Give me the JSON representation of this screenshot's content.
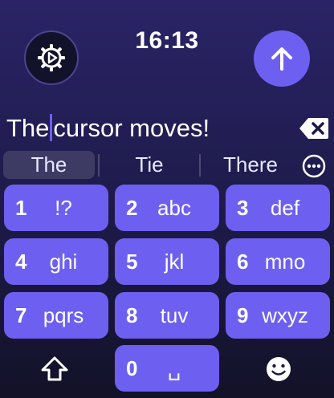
{
  "status": {
    "time": "16:13"
  },
  "input": {
    "before_cursor": "The",
    "after_cursor": "cursor moves!"
  },
  "suggestions": [
    "The",
    "Tie",
    "There"
  ],
  "keys": [
    {
      "num": "1",
      "letters": "!?"
    },
    {
      "num": "2",
      "letters": "abc"
    },
    {
      "num": "3",
      "letters": "def"
    },
    {
      "num": "4",
      "letters": "ghi"
    },
    {
      "num": "5",
      "letters": "jkl"
    },
    {
      "num": "6",
      "letters": "mno"
    },
    {
      "num": "7",
      "letters": "pqrs"
    },
    {
      "num": "8",
      "letters": "tuv"
    },
    {
      "num": "9",
      "letters": "wxyz"
    },
    {
      "num": "0",
      "letters": "␣"
    }
  ],
  "colors": {
    "accent": "#6d5ff0",
    "background_top": "#2a2466",
    "background_bottom": "#131228"
  },
  "icons": {
    "settings": "gear-play-icon",
    "send": "arrow-up-icon",
    "delete": "backspace-icon",
    "more": "ellipsis-icon",
    "shift": "shift-icon",
    "emoji": "emoji-icon"
  }
}
